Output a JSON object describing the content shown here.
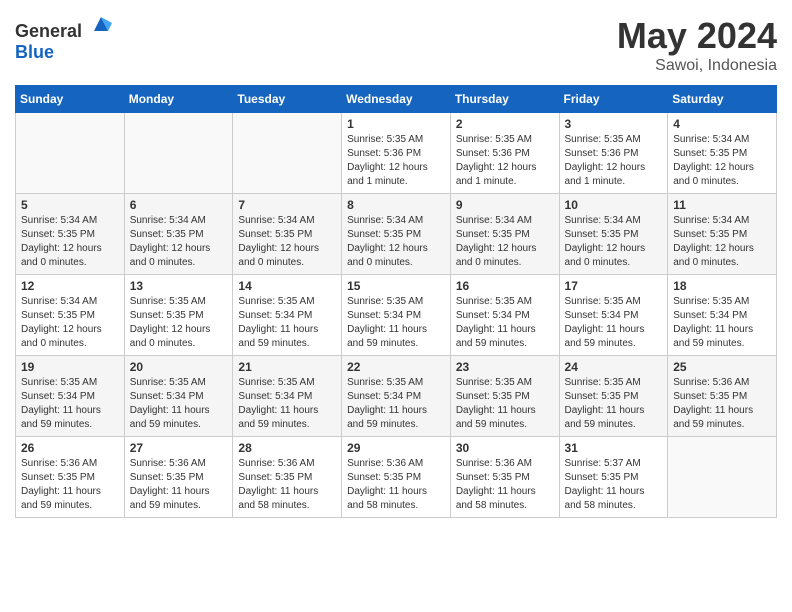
{
  "header": {
    "logo_general": "General",
    "logo_blue": "Blue",
    "title": "May 2024",
    "location": "Sawoi, Indonesia"
  },
  "days_of_week": [
    "Sunday",
    "Monday",
    "Tuesday",
    "Wednesday",
    "Thursday",
    "Friday",
    "Saturday"
  ],
  "weeks": [
    [
      {
        "day": "",
        "info": ""
      },
      {
        "day": "",
        "info": ""
      },
      {
        "day": "",
        "info": ""
      },
      {
        "day": "1",
        "info": "Sunrise: 5:35 AM\nSunset: 5:36 PM\nDaylight: 12 hours\nand 1 minute."
      },
      {
        "day": "2",
        "info": "Sunrise: 5:35 AM\nSunset: 5:36 PM\nDaylight: 12 hours\nand 1 minute."
      },
      {
        "day": "3",
        "info": "Sunrise: 5:35 AM\nSunset: 5:36 PM\nDaylight: 12 hours\nand 1 minute."
      },
      {
        "day": "4",
        "info": "Sunrise: 5:34 AM\nSunset: 5:35 PM\nDaylight: 12 hours\nand 0 minutes."
      }
    ],
    [
      {
        "day": "5",
        "info": "Sunrise: 5:34 AM\nSunset: 5:35 PM\nDaylight: 12 hours\nand 0 minutes."
      },
      {
        "day": "6",
        "info": "Sunrise: 5:34 AM\nSunset: 5:35 PM\nDaylight: 12 hours\nand 0 minutes."
      },
      {
        "day": "7",
        "info": "Sunrise: 5:34 AM\nSunset: 5:35 PM\nDaylight: 12 hours\nand 0 minutes."
      },
      {
        "day": "8",
        "info": "Sunrise: 5:34 AM\nSunset: 5:35 PM\nDaylight: 12 hours\nand 0 minutes."
      },
      {
        "day": "9",
        "info": "Sunrise: 5:34 AM\nSunset: 5:35 PM\nDaylight: 12 hours\nand 0 minutes."
      },
      {
        "day": "10",
        "info": "Sunrise: 5:34 AM\nSunset: 5:35 PM\nDaylight: 12 hours\nand 0 minutes."
      },
      {
        "day": "11",
        "info": "Sunrise: 5:34 AM\nSunset: 5:35 PM\nDaylight: 12 hours\nand 0 minutes."
      }
    ],
    [
      {
        "day": "12",
        "info": "Sunrise: 5:34 AM\nSunset: 5:35 PM\nDaylight: 12 hours\nand 0 minutes."
      },
      {
        "day": "13",
        "info": "Sunrise: 5:35 AM\nSunset: 5:35 PM\nDaylight: 12 hours\nand 0 minutes."
      },
      {
        "day": "14",
        "info": "Sunrise: 5:35 AM\nSunset: 5:34 PM\nDaylight: 11 hours\nand 59 minutes."
      },
      {
        "day": "15",
        "info": "Sunrise: 5:35 AM\nSunset: 5:34 PM\nDaylight: 11 hours\nand 59 minutes."
      },
      {
        "day": "16",
        "info": "Sunrise: 5:35 AM\nSunset: 5:34 PM\nDaylight: 11 hours\nand 59 minutes."
      },
      {
        "day": "17",
        "info": "Sunrise: 5:35 AM\nSunset: 5:34 PM\nDaylight: 11 hours\nand 59 minutes."
      },
      {
        "day": "18",
        "info": "Sunrise: 5:35 AM\nSunset: 5:34 PM\nDaylight: 11 hours\nand 59 minutes."
      }
    ],
    [
      {
        "day": "19",
        "info": "Sunrise: 5:35 AM\nSunset: 5:34 PM\nDaylight: 11 hours\nand 59 minutes."
      },
      {
        "day": "20",
        "info": "Sunrise: 5:35 AM\nSunset: 5:34 PM\nDaylight: 11 hours\nand 59 minutes."
      },
      {
        "day": "21",
        "info": "Sunrise: 5:35 AM\nSunset: 5:34 PM\nDaylight: 11 hours\nand 59 minutes."
      },
      {
        "day": "22",
        "info": "Sunrise: 5:35 AM\nSunset: 5:34 PM\nDaylight: 11 hours\nand 59 minutes."
      },
      {
        "day": "23",
        "info": "Sunrise: 5:35 AM\nSunset: 5:35 PM\nDaylight: 11 hours\nand 59 minutes."
      },
      {
        "day": "24",
        "info": "Sunrise: 5:35 AM\nSunset: 5:35 PM\nDaylight: 11 hours\nand 59 minutes."
      },
      {
        "day": "25",
        "info": "Sunrise: 5:36 AM\nSunset: 5:35 PM\nDaylight: 11 hours\nand 59 minutes."
      }
    ],
    [
      {
        "day": "26",
        "info": "Sunrise: 5:36 AM\nSunset: 5:35 PM\nDaylight: 11 hours\nand 59 minutes."
      },
      {
        "day": "27",
        "info": "Sunrise: 5:36 AM\nSunset: 5:35 PM\nDaylight: 11 hours\nand 59 minutes."
      },
      {
        "day": "28",
        "info": "Sunrise: 5:36 AM\nSunset: 5:35 PM\nDaylight: 11 hours\nand 58 minutes."
      },
      {
        "day": "29",
        "info": "Sunrise: 5:36 AM\nSunset: 5:35 PM\nDaylight: 11 hours\nand 58 minutes."
      },
      {
        "day": "30",
        "info": "Sunrise: 5:36 AM\nSunset: 5:35 PM\nDaylight: 11 hours\nand 58 minutes."
      },
      {
        "day": "31",
        "info": "Sunrise: 5:37 AM\nSunset: 5:35 PM\nDaylight: 11 hours\nand 58 minutes."
      },
      {
        "day": "",
        "info": ""
      }
    ]
  ]
}
